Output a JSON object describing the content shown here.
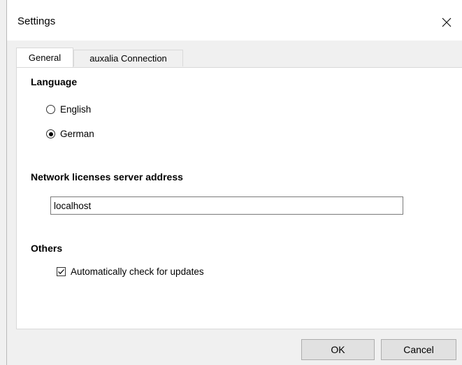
{
  "window": {
    "title": "Settings",
    "close_icon": "close-icon"
  },
  "tabs": [
    {
      "label": "General",
      "active": true
    },
    {
      "label": "auxalia Connection",
      "active": false
    }
  ],
  "language": {
    "heading": "Language",
    "options": [
      {
        "label": "English",
        "selected": false
      },
      {
        "label": "German",
        "selected": true
      }
    ]
  },
  "network": {
    "heading": "Network licenses server address",
    "value": "localhost"
  },
  "others": {
    "heading": "Others",
    "auto_update_label": "Automatically check for updates",
    "auto_update_checked": true
  },
  "buttons": {
    "ok": "OK",
    "cancel": "Cancel"
  }
}
